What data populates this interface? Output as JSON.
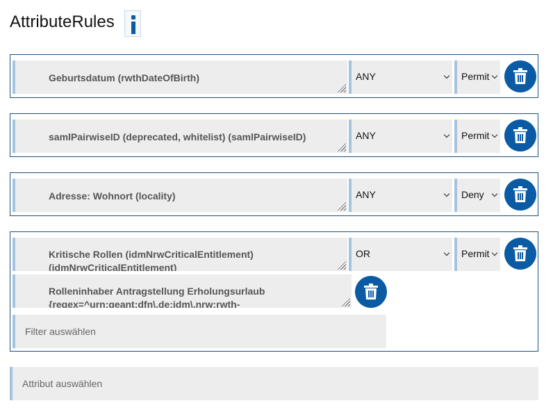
{
  "header": {
    "title": "AttributeRules",
    "info_icon": "info-icon"
  },
  "rules": [
    {
      "attribute": "Geburtsdatum (rwthDateOfBirth)",
      "match": "ANY",
      "action": "Permit"
    },
    {
      "attribute": "samlPairwiseID (deprecated, whitelist) (samlPairwiseID)",
      "match": "ANY",
      "action": "Permit"
    },
    {
      "attribute": "Adresse: Wohnort (locality)",
      "match": "ANY",
      "action": "Deny"
    },
    {
      "attribute": "Kritische Rollen (idmNrwCriticalEntitlement) (idmNrwCriticalEntitlement)",
      "match": "OR",
      "action": "Permit",
      "filter": "Rolleninhaber Antragstellung Erholungsurlaub {regex=^urn:geant:dfn\\.de:idm\\.nrw:rwth-",
      "filter_placeholder": "Filter auswählen"
    }
  ],
  "attribute_select_placeholder": "Attribut auswählen",
  "icons": {
    "delete": "trash-icon",
    "dropdown": "chevron-down-icon"
  },
  "colors": {
    "accent": "#0a5aa4",
    "border": "#1c4d80",
    "field_bg": "#ededed",
    "field_border": "#a6c3dd"
  }
}
